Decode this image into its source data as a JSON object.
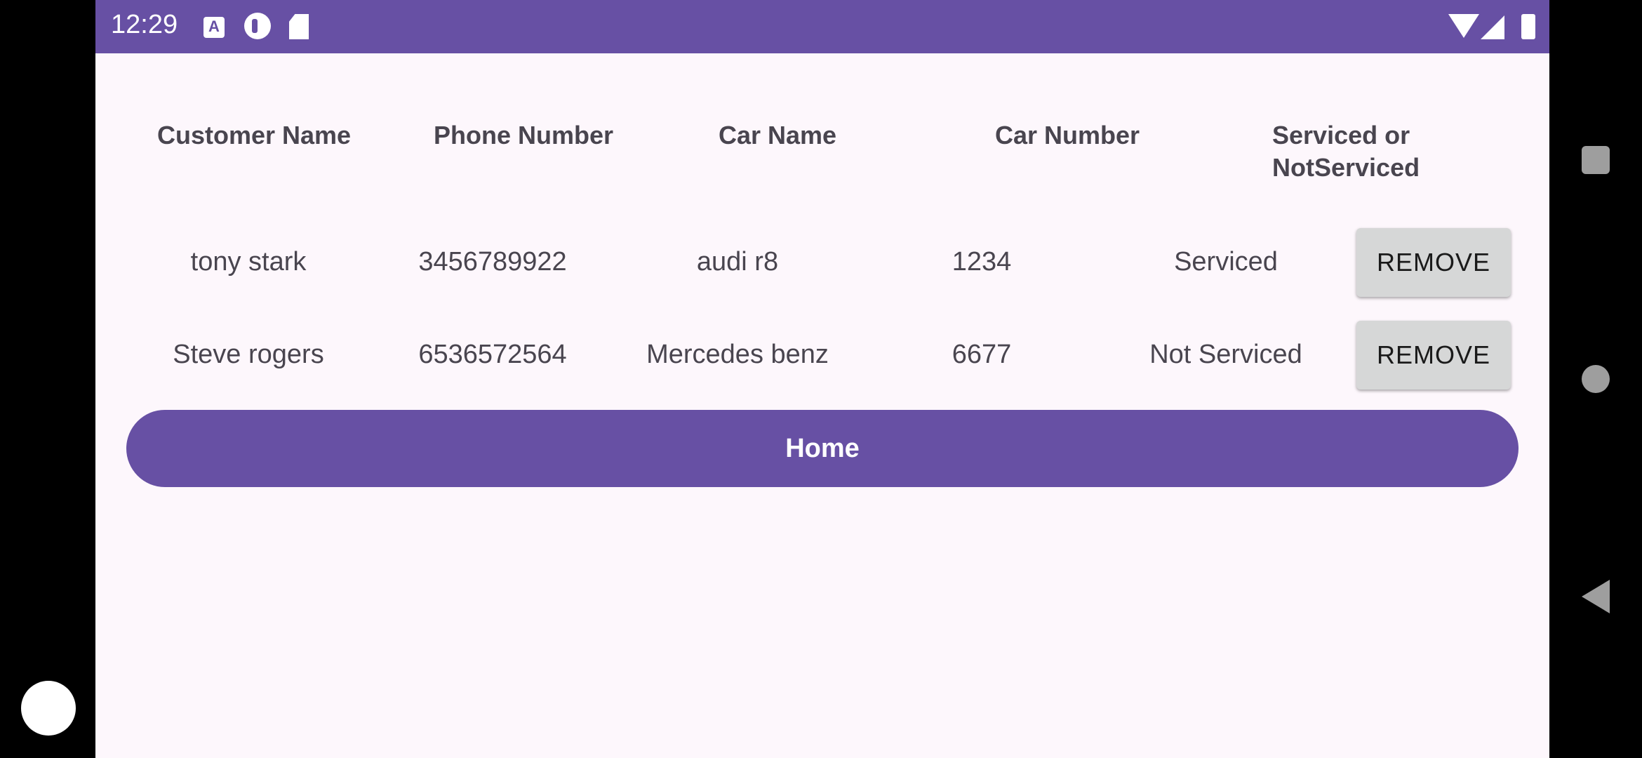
{
  "status_bar": {
    "time": "12:29",
    "icons": [
      "a-keyboard-icon",
      "p-app-icon",
      "sd-card-icon",
      "wifi-icon",
      "signal-icon",
      "battery-icon"
    ],
    "color": "#6750a4"
  },
  "table": {
    "headers": [
      "Customer Name",
      "Phone Number",
      "Car Name",
      "Car Number",
      "Serviced or NotServiced"
    ],
    "rows": [
      {
        "customer_name": "tony stark",
        "phone": "3456789922",
        "car_name": "audi r8",
        "car_number": "1234",
        "status": "Serviced",
        "action": "REMOVE"
      },
      {
        "customer_name": "Steve rogers",
        "phone": "6536572564",
        "car_name": "Mercedes benz",
        "car_number": "6677",
        "status": "Not Serviced",
        "action": "REMOVE"
      }
    ]
  },
  "home_button": {
    "label": "Home"
  },
  "navigation": {
    "icons": [
      "recents-icon",
      "home-icon",
      "back-icon"
    ]
  },
  "colors": {
    "accent": "#6750a4",
    "background": "#fdf7fc",
    "button_gray": "#d6d7d7",
    "text": "#49454f"
  }
}
